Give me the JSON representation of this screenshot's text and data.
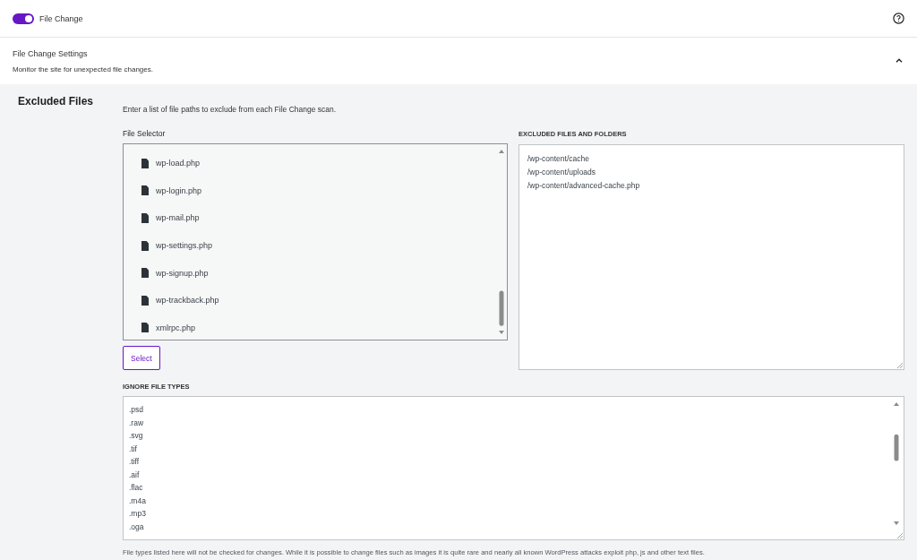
{
  "module": {
    "label": "File Change",
    "on": true
  },
  "settings": {
    "title": "File Change Settings",
    "description": "Monitor the site for unexpected file changes.",
    "expanded": true
  },
  "excluded_files": {
    "heading": "Excluded Files",
    "intro": "Enter a list of file paths to exclude from each File Change scan.",
    "file_selector": {
      "label": "File Selector",
      "items": [
        {
          "name": "wp-load.php"
        },
        {
          "name": "wp-login.php"
        },
        {
          "name": "wp-mail.php"
        },
        {
          "name": "wp-settings.php"
        },
        {
          "name": "wp-signup.php"
        },
        {
          "name": "wp-trackback.php"
        },
        {
          "name": "xmlrpc.php"
        }
      ],
      "button": "Select"
    },
    "excluded_list": {
      "label": "EXCLUDED FILES AND FOLDERS",
      "lines": [
        "/wp-content/cache",
        "/wp-content/uploads",
        "/wp-content/advanced-cache.php"
      ]
    }
  },
  "ignore_types": {
    "label": "IGNORE FILE TYPES",
    "lines": [
      ".psd",
      ".raw",
      ".svg",
      ".tif",
      ".tiff",
      ".aif",
      ".flac",
      ".m4a",
      ".mp3",
      ".oga"
    ],
    "help": "File types listed here will not be checked for changes. While it is possible to change files such as images it is quite rare and nearly all known WordPress attacks exploit php, js and other text files."
  }
}
